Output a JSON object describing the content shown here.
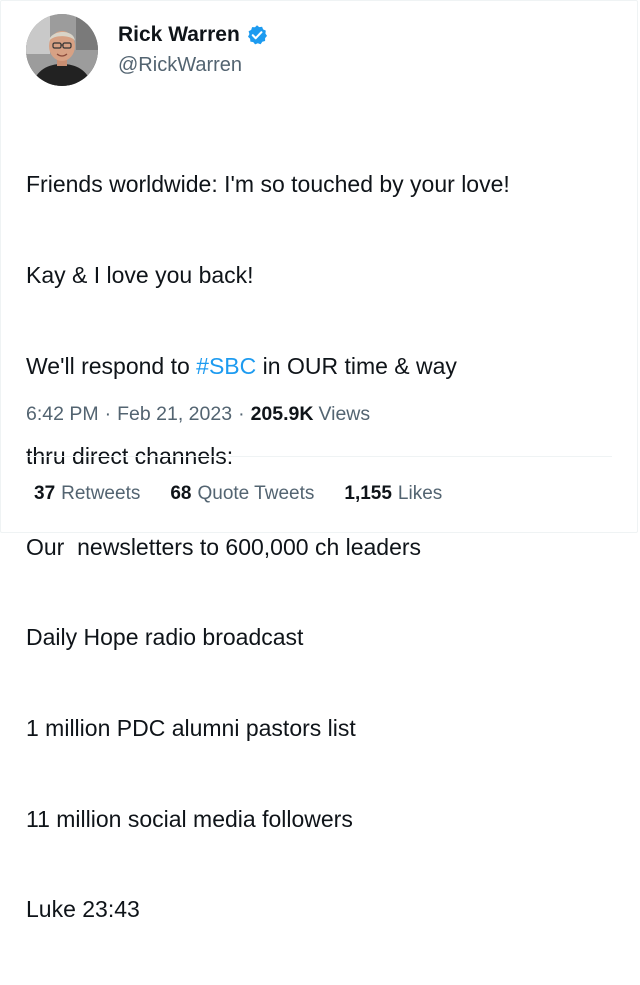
{
  "author": {
    "display_name": "Rick Warren",
    "handle": "@RickWarren",
    "verified_icon": "verified-badge-icon",
    "verified_color": "#1d9bf0"
  },
  "tweet": {
    "lines": [
      {
        "text": "Friends worldwide: I'm so touched by your love!"
      },
      {
        "text": "Kay & I love you back!"
      },
      {
        "before": "We'll respond to ",
        "hashtag": "#SBC",
        "after": " in OUR time & way"
      },
      {
        "text": "thru direct channels:"
      },
      {
        "text": "Our  newsletters to 600,000 ch leaders"
      },
      {
        "text": "Daily Hope radio broadcast"
      },
      {
        "text": "1 million PDC alumni pastors list"
      },
      {
        "text": "11 million social media followers"
      },
      {
        "text": "Luke 23:43"
      }
    ]
  },
  "meta": {
    "time": "6:42 PM",
    "separator": "·",
    "date": "Feb 21, 2023",
    "views_count": "205.9K",
    "views_label": "Views"
  },
  "stats": {
    "retweets_count": "37",
    "retweets_label": "Retweets",
    "quotes_count": "68",
    "quotes_label": "Quote Tweets",
    "likes_count": "1,155",
    "likes_label": "Likes"
  },
  "colors": {
    "text": "#0f1419",
    "secondary": "#536471",
    "link": "#1d9bf0",
    "border": "#eff3f4"
  }
}
